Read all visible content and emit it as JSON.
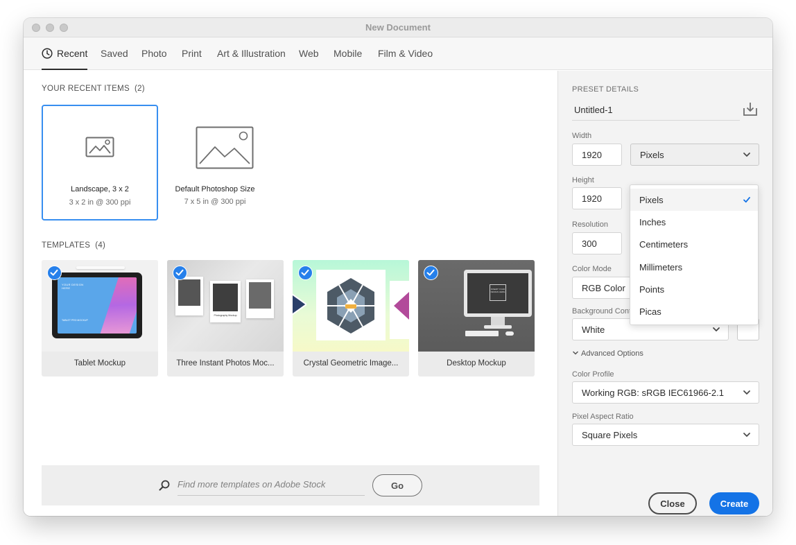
{
  "window": {
    "title": "New Document"
  },
  "tabs": [
    "Recent",
    "Saved",
    "Photo",
    "Print",
    "Art & Illustration",
    "Web",
    "Mobile",
    "Film & Video"
  ],
  "recent": {
    "label": "YOUR RECENT ITEMS",
    "count": "(2)",
    "items": [
      {
        "name": "Landscape, 3 x 2",
        "sub": "3 x 2 in @ 300 ppi",
        "selected": true
      },
      {
        "name": "Default Photoshop Size",
        "sub": "7 x 5 in @ 300 ppi",
        "selected": false
      }
    ]
  },
  "templates": {
    "label": "TEMPLATES",
    "count": "(4)",
    "items": [
      {
        "name": "Tablet Mockup",
        "thumb_text": "YOUR DESIGN HERE",
        "thumb_caption": "TABLET PRO MOCKUP"
      },
      {
        "name": "Three Instant Photos Moc...",
        "thumb_caption": "Photography Mockup"
      },
      {
        "name": "Crystal Geometric Image..."
      },
      {
        "name": "Desktop Mockup",
        "thumb_text": "INSERT YOUR DESIGN HERE"
      }
    ]
  },
  "stock": {
    "placeholder": "Find more templates on Adobe Stock",
    "go_label": "Go"
  },
  "preset": {
    "label": "PRESET DETAILS",
    "name": "Untitled-1",
    "width_label": "Width",
    "width_value": "1920",
    "width_unit": "Pixels",
    "height_label": "Height",
    "height_value": "1920",
    "resolution_label": "Resolution",
    "resolution_value": "300",
    "color_mode_label": "Color Mode",
    "color_mode_value": "RGB Color",
    "background_label": "Background Contents",
    "background_value": "White",
    "advanced_label": "Advanced Options",
    "color_profile_label": "Color Profile",
    "color_profile_value": "Working RGB: sRGB IEC61966-2.1",
    "pixel_aspect_label": "Pixel Aspect Ratio",
    "pixel_aspect_value": "Square Pixels"
  },
  "unit_menu": {
    "options": [
      "Pixels",
      "Inches",
      "Centimeters",
      "Millimeters",
      "Points",
      "Picas"
    ],
    "selected": "Pixels"
  },
  "buttons": {
    "close": "Close",
    "create": "Create"
  },
  "colors": {
    "accent": "#1473e6",
    "selection_border": "#378ef0",
    "check_badge": "#2680eb"
  }
}
